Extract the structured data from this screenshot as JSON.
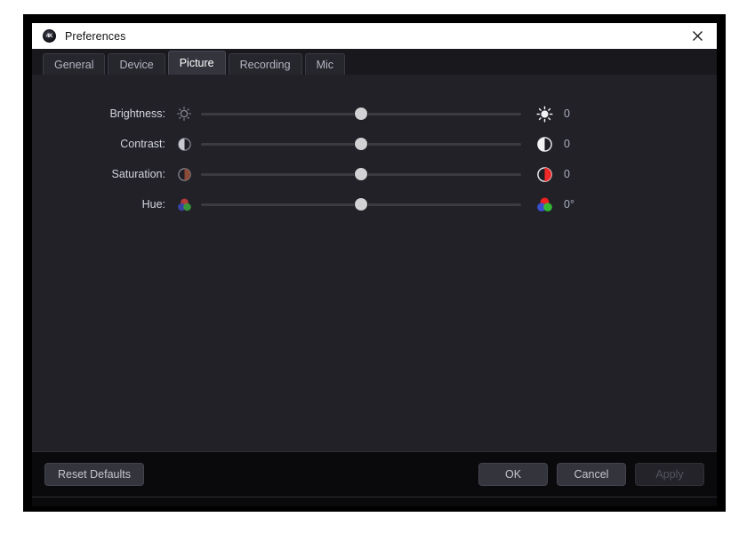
{
  "window": {
    "title": "Preferences",
    "app_icon": "4K",
    "close_icon": "close-icon"
  },
  "tabs": [
    {
      "label": "General",
      "active": false
    },
    {
      "label": "Device",
      "active": false
    },
    {
      "label": "Picture",
      "active": true
    },
    {
      "label": "Recording",
      "active": false
    },
    {
      "label": "Mic",
      "active": false
    }
  ],
  "picture": {
    "rows": [
      {
        "label": "Brightness:",
        "icon_left": "brightness-low-icon",
        "icon_right": "brightness-high-icon",
        "value": "0",
        "position_pct": 50
      },
      {
        "label": "Contrast:",
        "icon_left": "contrast-low-icon",
        "icon_right": "contrast-high-icon",
        "value": "0",
        "position_pct": 50
      },
      {
        "label": "Saturation:",
        "icon_left": "saturation-low-icon",
        "icon_right": "saturation-high-icon",
        "value": "0",
        "position_pct": 50
      },
      {
        "label": "Hue:",
        "icon_left": "hue-low-icon",
        "icon_right": "hue-high-icon",
        "value": "0°",
        "position_pct": 50
      }
    ]
  },
  "footer": {
    "reset_label": "Reset Defaults",
    "ok_label": "OK",
    "cancel_label": "Cancel",
    "apply_label": "Apply",
    "apply_enabled": false
  },
  "colors": {
    "window_bg": "#212127",
    "titlebar_bg": "#ffffff",
    "tabbar_bg": "#18181d",
    "footer_bg": "#0a0a0c",
    "accent_red": "#e03030",
    "accent_green": "#3fbf3f",
    "accent_blue": "#4a5fd0",
    "thumb": "#d2d2d4",
    "track": "#3b3b42"
  }
}
